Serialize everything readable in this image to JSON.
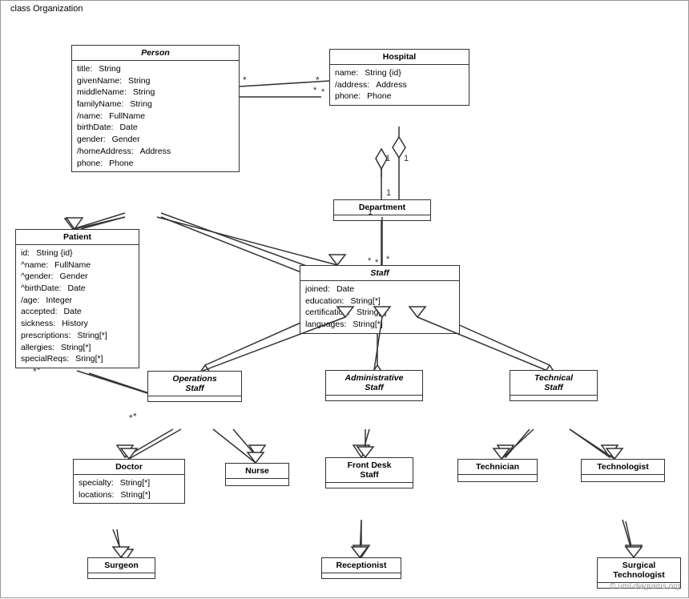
{
  "diagram": {
    "title": "class Organization",
    "classes": {
      "person": {
        "name": "Person",
        "italic": true,
        "attrs": [
          {
            "name": "title:",
            "type": "String"
          },
          {
            "name": "givenName:",
            "type": "String"
          },
          {
            "name": "middleName:",
            "type": "String"
          },
          {
            "name": "familyName:",
            "type": "String"
          },
          {
            "name": "/name:",
            "type": "FullName"
          },
          {
            "name": "birthDate:",
            "type": "Date"
          },
          {
            "name": "gender:",
            "type": "Gender"
          },
          {
            "name": "/homeAddress:",
            "type": "Address"
          },
          {
            "name": "phone:",
            "type": "Phone"
          }
        ]
      },
      "hospital": {
        "name": "Hospital",
        "italic": false,
        "attrs": [
          {
            "name": "name:",
            "type": "String {id}"
          },
          {
            "name": "/address:",
            "type": "Address"
          },
          {
            "name": "phone:",
            "type": "Phone"
          }
        ]
      },
      "department": {
        "name": "Department",
        "italic": false,
        "attrs": []
      },
      "staff": {
        "name": "Staff",
        "italic": true,
        "attrs": [
          {
            "name": "joined:",
            "type": "Date"
          },
          {
            "name": "education:",
            "type": "String[*]"
          },
          {
            "name": "certification:",
            "type": "String[*]"
          },
          {
            "name": "languages:",
            "type": "String[*]"
          }
        ]
      },
      "patient": {
        "name": "Patient",
        "italic": false,
        "attrs": [
          {
            "name": "id:",
            "type": "String {id}"
          },
          {
            "name": "^name:",
            "type": "FullName"
          },
          {
            "name": "^gender:",
            "type": "Gender"
          },
          {
            "name": "^birthDate:",
            "type": "Date"
          },
          {
            "name": "/age:",
            "type": "Integer"
          },
          {
            "name": "accepted:",
            "type": "Date"
          },
          {
            "name": "sickness:",
            "type": "History"
          },
          {
            "name": "prescriptions:",
            "type": "String[*]"
          },
          {
            "name": "allergies:",
            "type": "String[*]"
          },
          {
            "name": "specialReqs:",
            "type": "Sring[*]"
          }
        ]
      },
      "operations_staff": {
        "name": "Operations Staff",
        "italic": true
      },
      "administrative_staff": {
        "name": "Administrative Staff",
        "italic": true
      },
      "technical_staff": {
        "name": "Technical Staff",
        "italic": true
      },
      "doctor": {
        "name": "Doctor",
        "italic": false,
        "attrs": [
          {
            "name": "specialty:",
            "type": "String[*]"
          },
          {
            "name": "locations:",
            "type": "String[*]"
          }
        ]
      },
      "nurse": {
        "name": "Nurse",
        "italic": false,
        "attrs": []
      },
      "front_desk_staff": {
        "name": "Front Desk Staff",
        "italic": false,
        "attrs": []
      },
      "technician": {
        "name": "Technician",
        "italic": false,
        "attrs": []
      },
      "technologist": {
        "name": "Technologist",
        "italic": false,
        "attrs": []
      },
      "surgeon": {
        "name": "Surgeon",
        "italic": false,
        "attrs": []
      },
      "receptionist": {
        "name": "Receptionist",
        "italic": false,
        "attrs": []
      },
      "surgical_technologist": {
        "name": "Surgical Technologist",
        "italic": false,
        "attrs": []
      }
    },
    "watermark": "© uml-diagrams.org"
  }
}
